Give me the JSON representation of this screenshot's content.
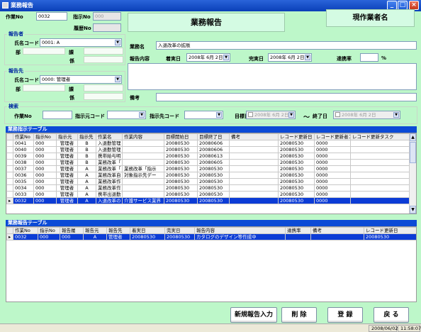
{
  "window": {
    "title": "業務報告"
  },
  "header": {
    "sagyo_no_label": "作業No",
    "sagyo_no": "0032",
    "shiji_no_label": "指示No",
    "shiji_no": "000",
    "rireki_no_label": "履歴No",
    "page_title": "業務報告",
    "current_worker_label": "現作業者名"
  },
  "reporter": {
    "group": "報告者",
    "name_code_label": "氏名コード",
    "name_code": "0001: A",
    "dept_label": "部",
    "section_label": "課",
    "staff_label": "係"
  },
  "destination": {
    "group": "報告先",
    "name_code_label": "氏名コード",
    "name_code": "0000: 管理者",
    "dept_label": "部",
    "section_label": "課",
    "staff_label": "係"
  },
  "task": {
    "name_label": "業務名",
    "name": "入退改革の拡販",
    "content_label": "報告内容",
    "start_label": "着実日",
    "start_date": "2008年 6月 2日",
    "end_label": "完実日",
    "end_date": "2008年 6月 2日",
    "rate_label": "達携率",
    "rate_unit": "%",
    "notes_label": "備考"
  },
  "search": {
    "group": "検索",
    "sagyo_no_label": "作業No",
    "shiji_code_label": "指示元コード",
    "dest_code_label": "指示先コード",
    "target_label": "目標日",
    "target_date": "2008年 6月 2日",
    "tilde": "～",
    "end_label": "終了日",
    "end_date": "2008年 6月 2日"
  },
  "instruction_table": {
    "title": "業務指示テーブル",
    "columns": [
      "作業No",
      "指示No",
      "指示元",
      "指示先",
      "作業名",
      "作業内容",
      "目標開始日",
      "目標終了日",
      "備考",
      "レコード更新日",
      "レコード更新者コード",
      "レコード更新タスク"
    ],
    "rows": [
      {
        "marker": "",
        "cells": [
          "0041",
          "000",
          "管理者",
          "B",
          "入退勤管理",
          "",
          "20080530",
          "20080606",
          "",
          "20080530",
          "0000",
          ""
        ]
      },
      {
        "marker": "",
        "cells": [
          "0040",
          "000",
          "管理者",
          "B",
          "入退勤管理",
          "",
          "20080530",
          "20080606",
          "",
          "20080530",
          "0000",
          ""
        ]
      },
      {
        "marker": "",
        "cells": [
          "0039",
          "000",
          "管理者",
          "B",
          "携帯給与明",
          "",
          "20080530",
          "20080613",
          "",
          "20080530",
          "0000",
          ""
        ]
      },
      {
        "marker": "",
        "cells": [
          "0038",
          "000",
          "管理者",
          "B",
          "業務改革「",
          "",
          "20080530",
          "20080605",
          "",
          "20080530",
          "0000",
          ""
        ]
      },
      {
        "marker": "",
        "cells": [
          "0037",
          "000",
          "管理者",
          "A",
          "業務改革「",
          "業務改革「指示",
          "20080530",
          "20080530",
          "",
          "20080530",
          "0000",
          ""
        ]
      },
      {
        "marker": "",
        "cells": [
          "0036",
          "000",
          "管理者",
          "A",
          "業務改革自",
          "対象指示先デー",
          "20080530",
          "20080530",
          "",
          "20080530",
          "0000",
          ""
        ]
      },
      {
        "marker": "",
        "cells": [
          "0035",
          "000",
          "管理者",
          "A",
          "業務改革作",
          "",
          "20080530",
          "20080530",
          "",
          "20080530",
          "0000",
          ""
        ]
      },
      {
        "marker": "",
        "cells": [
          "0034",
          "000",
          "管理者",
          "A",
          "業務改革作",
          "",
          "20080530",
          "20080530",
          "",
          "20080530",
          "0000",
          ""
        ]
      },
      {
        "marker": "",
        "cells": [
          "0033",
          "000",
          "管理者",
          "A",
          "携帯出退勤",
          "",
          "20080530",
          "20080530",
          "",
          "20080530",
          "0000",
          ""
        ]
      },
      {
        "marker": "▸",
        "cells": [
          "0032",
          "000",
          "管理者",
          "A",
          "入退改革の",
          "介護サービス業界",
          "20080530",
          "20080530",
          "",
          "20080530",
          "0000",
          ""
        ]
      }
    ]
  },
  "report_table": {
    "title": "業務報告テーブル",
    "columns": [
      "作業No",
      "指示No",
      "報告履",
      "報告元",
      "報告先",
      "着実日",
      "完実日",
      "報告内容",
      "達携率",
      "備考",
      "レコード更新日"
    ],
    "rows": [
      {
        "marker": "▸",
        "cells": [
          "0032",
          "000",
          "000",
          "A",
          "管理者",
          "20080530",
          "20080530",
          "カタログのデザイン等作成中",
          "",
          "",
          "20080530"
        ]
      }
    ]
  },
  "buttons": {
    "new_report": "新規報告入力",
    "delete": "削 除",
    "register": "登 録",
    "back": "戻 る"
  },
  "status": {
    "date": "2008/06/02",
    "time": "11:58:07"
  }
}
